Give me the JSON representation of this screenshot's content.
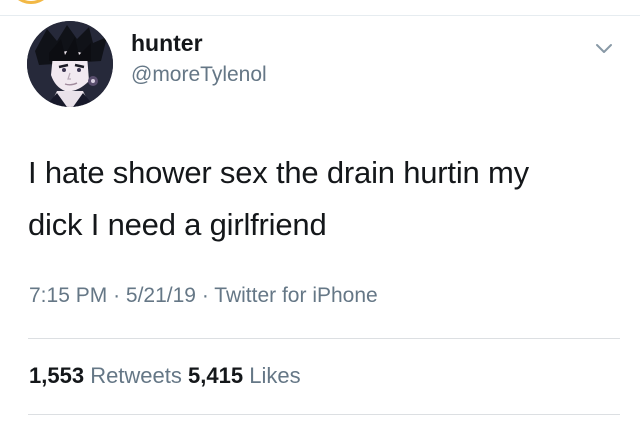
{
  "user": {
    "display_name": "hunter",
    "handle": "@moreTylenol",
    "avatar_icon": "anime-character-avatar"
  },
  "tweet": {
    "text_line1": "I hate shower sex the drain hurtin my",
    "text_line2": "dick I need a girlfriend",
    "time": "7:15 PM",
    "date": "5/21/19",
    "source": "Twitter for iPhone",
    "separator": "·"
  },
  "stats": {
    "retweets_count": "1,553",
    "retweets_label": "Retweets",
    "likes_count": "5,415",
    "likes_label": "Likes"
  },
  "colors": {
    "text_primary": "#14171a",
    "text_secondary": "#657786",
    "divider": "#dcdfe2",
    "top_arc_accent": "#f2b845"
  }
}
